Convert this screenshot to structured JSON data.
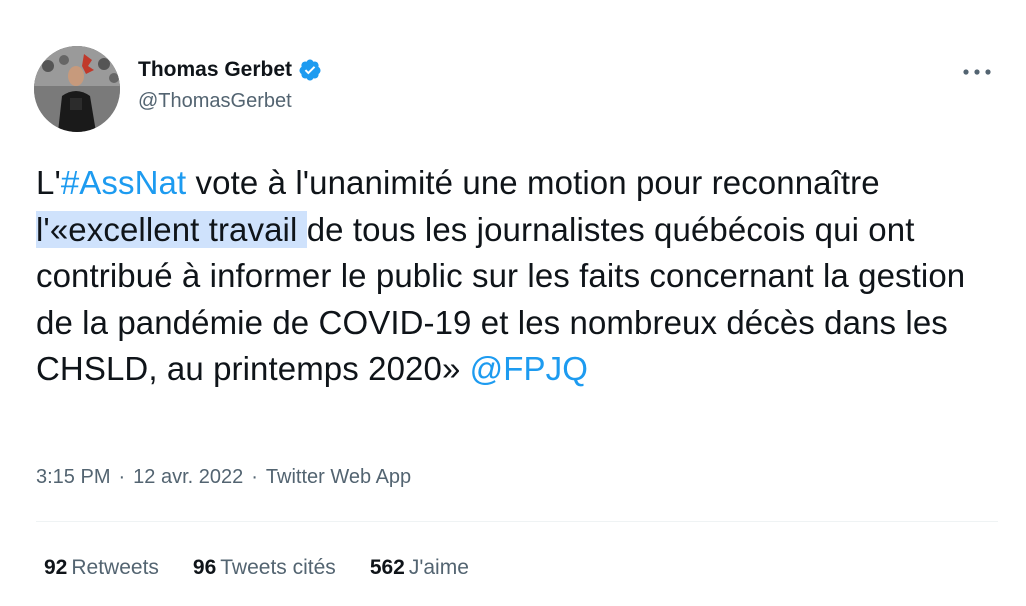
{
  "author": {
    "display_name": "Thomas Gerbet",
    "handle": "@ThomasGerbet",
    "verified": true
  },
  "tweet": {
    "seg1": "L'",
    "hashtag": "#AssNat",
    "seg2": " vote à l'unanimité une motion pour reconnaître ",
    "highlighted": "l'«excellent travail ",
    "seg3": "de tous les journalistes québécois qui ont contribué à informer le public sur les faits concernant la gestion de la pandémie de COVID-19 et les nombreux décès dans les CHSLD, au printemps 2020» ",
    "mention": "@FPJQ"
  },
  "meta": {
    "time": "3:15 PM",
    "separator": "·",
    "date": "12 avr. 2022",
    "source": "Twitter Web App"
  },
  "stats": {
    "retweets": {
      "count": "92",
      "label": "Retweets"
    },
    "quotes": {
      "count": "96",
      "label": "Tweets cités"
    },
    "likes": {
      "count": "562",
      "label": "J'aime"
    }
  },
  "colors": {
    "link": "#1d9bf0",
    "secondary_text": "#536471",
    "highlight": "#cfe2fc",
    "verified_badge": "#1d9bf0"
  },
  "icons": {
    "verified": "verified-badge-icon",
    "more": "more-options-icon"
  }
}
